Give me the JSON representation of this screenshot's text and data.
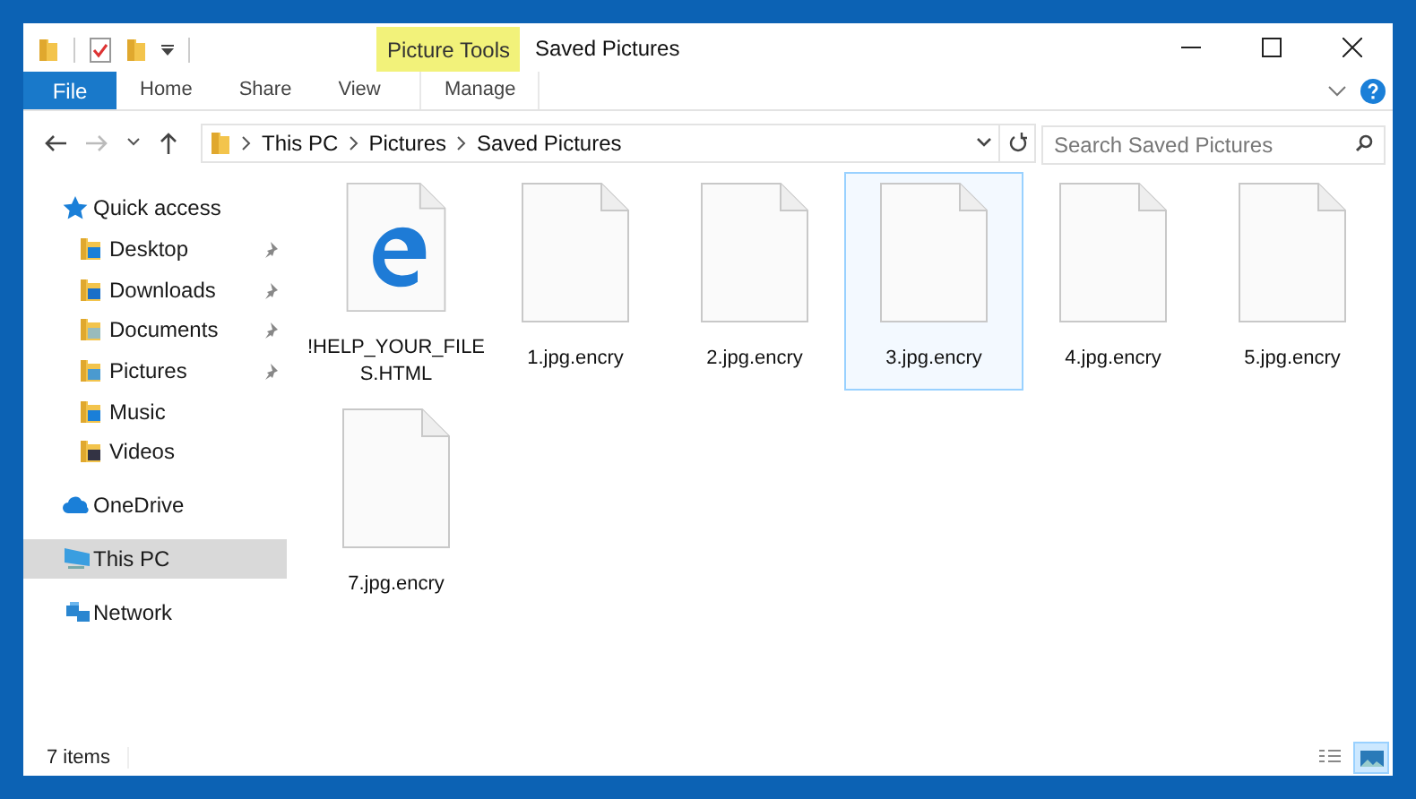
{
  "window": {
    "title": "Saved Pictures",
    "context_tab": "Picture Tools"
  },
  "ribbon_tabs": [
    {
      "label": "File",
      "kind": "file",
      "selected": false
    },
    {
      "label": "Home",
      "kind": "tab",
      "selected": false
    },
    {
      "label": "Share",
      "kind": "tab",
      "selected": false
    },
    {
      "label": "View",
      "kind": "tab",
      "selected": false
    },
    {
      "label": "Manage",
      "kind": "context",
      "selected": false
    }
  ],
  "address": {
    "path": [
      "This PC",
      "Pictures",
      "Saved Pictures"
    ]
  },
  "search": {
    "placeholder": "Search Saved Pictures"
  },
  "nav": [
    {
      "label": "Quick access",
      "kind": "star",
      "selected": false,
      "children": [
        {
          "label": "Desktop",
          "kind": "desktop",
          "pinned": true,
          "selected": false
        },
        {
          "label": "Downloads",
          "kind": "downloads",
          "pinned": true,
          "selected": false
        },
        {
          "label": "Documents",
          "kind": "documents",
          "pinned": true,
          "selected": false
        },
        {
          "label": "Pictures",
          "kind": "pictures",
          "pinned": true,
          "selected": false
        },
        {
          "label": "Music",
          "kind": "music",
          "pinned": false,
          "selected": false
        },
        {
          "label": "Videos",
          "kind": "videos",
          "pinned": false,
          "selected": false
        }
      ]
    },
    {
      "label": "OneDrive",
      "kind": "cloud",
      "selected": false
    },
    {
      "label": "This PC",
      "kind": "pc",
      "selected": true
    },
    {
      "label": "Network",
      "kind": "network",
      "selected": false
    }
  ],
  "files": [
    {
      "name": "!HELP_YOUR_FILE\nS.HTML",
      "kind": "html",
      "selected": false
    },
    {
      "name": "1.jpg.encry",
      "kind": "blank",
      "selected": false
    },
    {
      "name": "2.jpg.encry",
      "kind": "blank",
      "selected": false
    },
    {
      "name": "3.jpg.encry",
      "kind": "blank",
      "selected": true
    },
    {
      "name": "4.jpg.encry",
      "kind": "blank",
      "selected": false
    },
    {
      "name": "5.jpg.encry",
      "kind": "blank",
      "selected": false
    },
    {
      "name": "7.jpg.encry",
      "kind": "blank",
      "selected": false
    }
  ],
  "status_bar": {
    "text": "7 items",
    "views": [
      {
        "kind": "details",
        "selected": false
      },
      {
        "kind": "large-icons",
        "selected": true
      }
    ]
  }
}
